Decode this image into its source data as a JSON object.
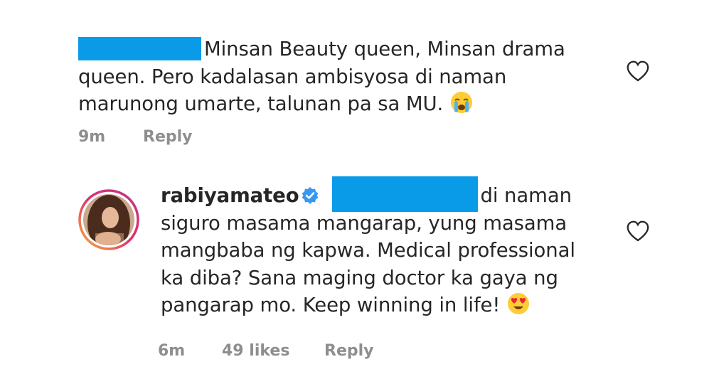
{
  "comment1": {
    "line1": "Minsan Beauty queen, Minsan drama",
    "line2": "queen. Pero kadalasan ambisyosa di naman",
    "line3": "marunong umarte, talunan pa sa MU.",
    "time": "9m",
    "reply_label": "Reply",
    "emoji": "loudly-crying-face-icon"
  },
  "comment2": {
    "username": "rabiyamateo",
    "line1_suffix": "di naman",
    "line2": "siguro masama mangarap, yung masama",
    "line3": "mangbaba ng kapwa. Medical professional",
    "line4": "ka diba? Sana maging doctor ka gaya ng",
    "line5": "pangarap mo. Keep winning in life!",
    "time": "6m",
    "likes": "49 likes",
    "reply_label": "Reply",
    "emoji": "heart-eyes-face-icon"
  },
  "colors": {
    "redaction": "#0a9be8",
    "text": "#262626",
    "meta": "#8e8e8e",
    "verified": "#3897f0",
    "story_ring": "#e1306c"
  }
}
